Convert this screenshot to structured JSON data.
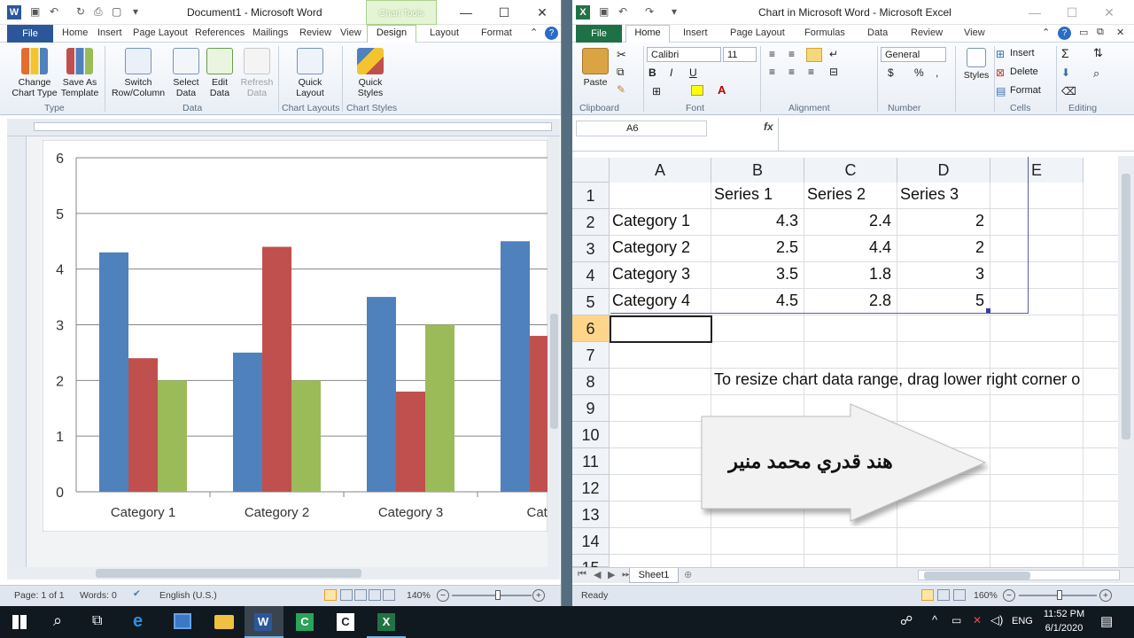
{
  "word": {
    "title": "Document1 - Microsoft Word",
    "contextual_group": "Chart Tools",
    "file_tab": "File",
    "tabs": [
      "Home",
      "Insert",
      "Page Layout",
      "References",
      "Mailings",
      "Review",
      "View",
      "Design",
      "Layout",
      "Format"
    ],
    "ribbon_buttons": {
      "change_chart_type": "Change Chart Type",
      "save_as_template": "Save As Template",
      "switch_row_column": "Switch Row/Column",
      "select_data": "Select Data",
      "edit_data": "Edit Data",
      "refresh_data": "Refresh Data",
      "quick_layout": "Quick Layout",
      "quick_styles": "Quick Styles"
    },
    "groups": {
      "type": "Type",
      "data": "Data",
      "chart_layouts": "Chart Layouts",
      "chart_styles": "Chart Styles"
    },
    "status": {
      "page": "Page: 1 of 1",
      "words": "Words: 0",
      "language": "English (U.S.)",
      "zoom": "140%"
    },
    "zoom_level": 0.58
  },
  "excel": {
    "title": "Chart in Microsoft Word - Microsoft Excel",
    "file_tab": "File",
    "tabs": [
      "Home",
      "Insert",
      "Page Layout",
      "Formulas",
      "Data",
      "Review",
      "View"
    ],
    "ribbon": {
      "paste": "Paste",
      "font_name": "Calibri",
      "font_size": "11",
      "number_format": "General",
      "styles": "Styles",
      "insert": "Insert",
      "delete": "Delete",
      "format": "Format",
      "currency": "$",
      "percent": "%",
      "comma": ","
    },
    "groups": {
      "clipboard": "Clipboard",
      "font": "Font",
      "alignment": "Alignment",
      "number": "Number",
      "cells": "Cells",
      "editing": "Editing"
    },
    "name_box": "A6",
    "fx": "fx",
    "columns": [
      "A",
      "B",
      "C",
      "D",
      "E"
    ],
    "rows": [
      "1",
      "2",
      "3",
      "4",
      "5",
      "6",
      "7",
      "8",
      "9",
      "10",
      "11",
      "12",
      "13",
      "14",
      "15"
    ],
    "headers": [
      "Series 1",
      "Series 2",
      "Series 3"
    ],
    "data_rows": [
      {
        "label": "Category 1",
        "v": [
          "4.3",
          "2.4",
          "2"
        ]
      },
      {
        "label": "Category 2",
        "v": [
          "2.5",
          "4.4",
          "2"
        ]
      },
      {
        "label": "Category 3",
        "v": [
          "3.5",
          "1.8",
          "3"
        ]
      },
      {
        "label": "Category 4",
        "v": [
          "4.5",
          "2.8",
          "5"
        ]
      }
    ],
    "note": "To resize chart data range, drag lower right corner o",
    "sheet_tab": "Sheet1",
    "status": {
      "ready": "Ready",
      "zoom": "160%"
    },
    "zoom_level": 0.52
  },
  "overlay": {
    "arabic_text": "هند قدري محمد منير"
  },
  "taskbar": {
    "time": "11:52 PM",
    "date": "6/1/2020",
    "lang": "ENG"
  },
  "chart_data": {
    "type": "bar",
    "categories": [
      "Category 1",
      "Category 2",
      "Category 3",
      "Categ"
    ],
    "series": [
      {
        "name": "Series 1",
        "values": [
          4.3,
          2.5,
          3.5,
          4.5
        ],
        "color": "#4f81bd"
      },
      {
        "name": "Series 2",
        "values": [
          2.4,
          4.4,
          1.8,
          2.8
        ],
        "color": "#c0504d"
      },
      {
        "name": "Series 3",
        "values": [
          2,
          2,
          3,
          5
        ],
        "color": "#9bbb59"
      }
    ],
    "ylim": [
      0,
      6
    ],
    "yticks": [
      "0",
      "1",
      "2",
      "3",
      "4",
      "5",
      "6"
    ],
    "grid": true
  }
}
